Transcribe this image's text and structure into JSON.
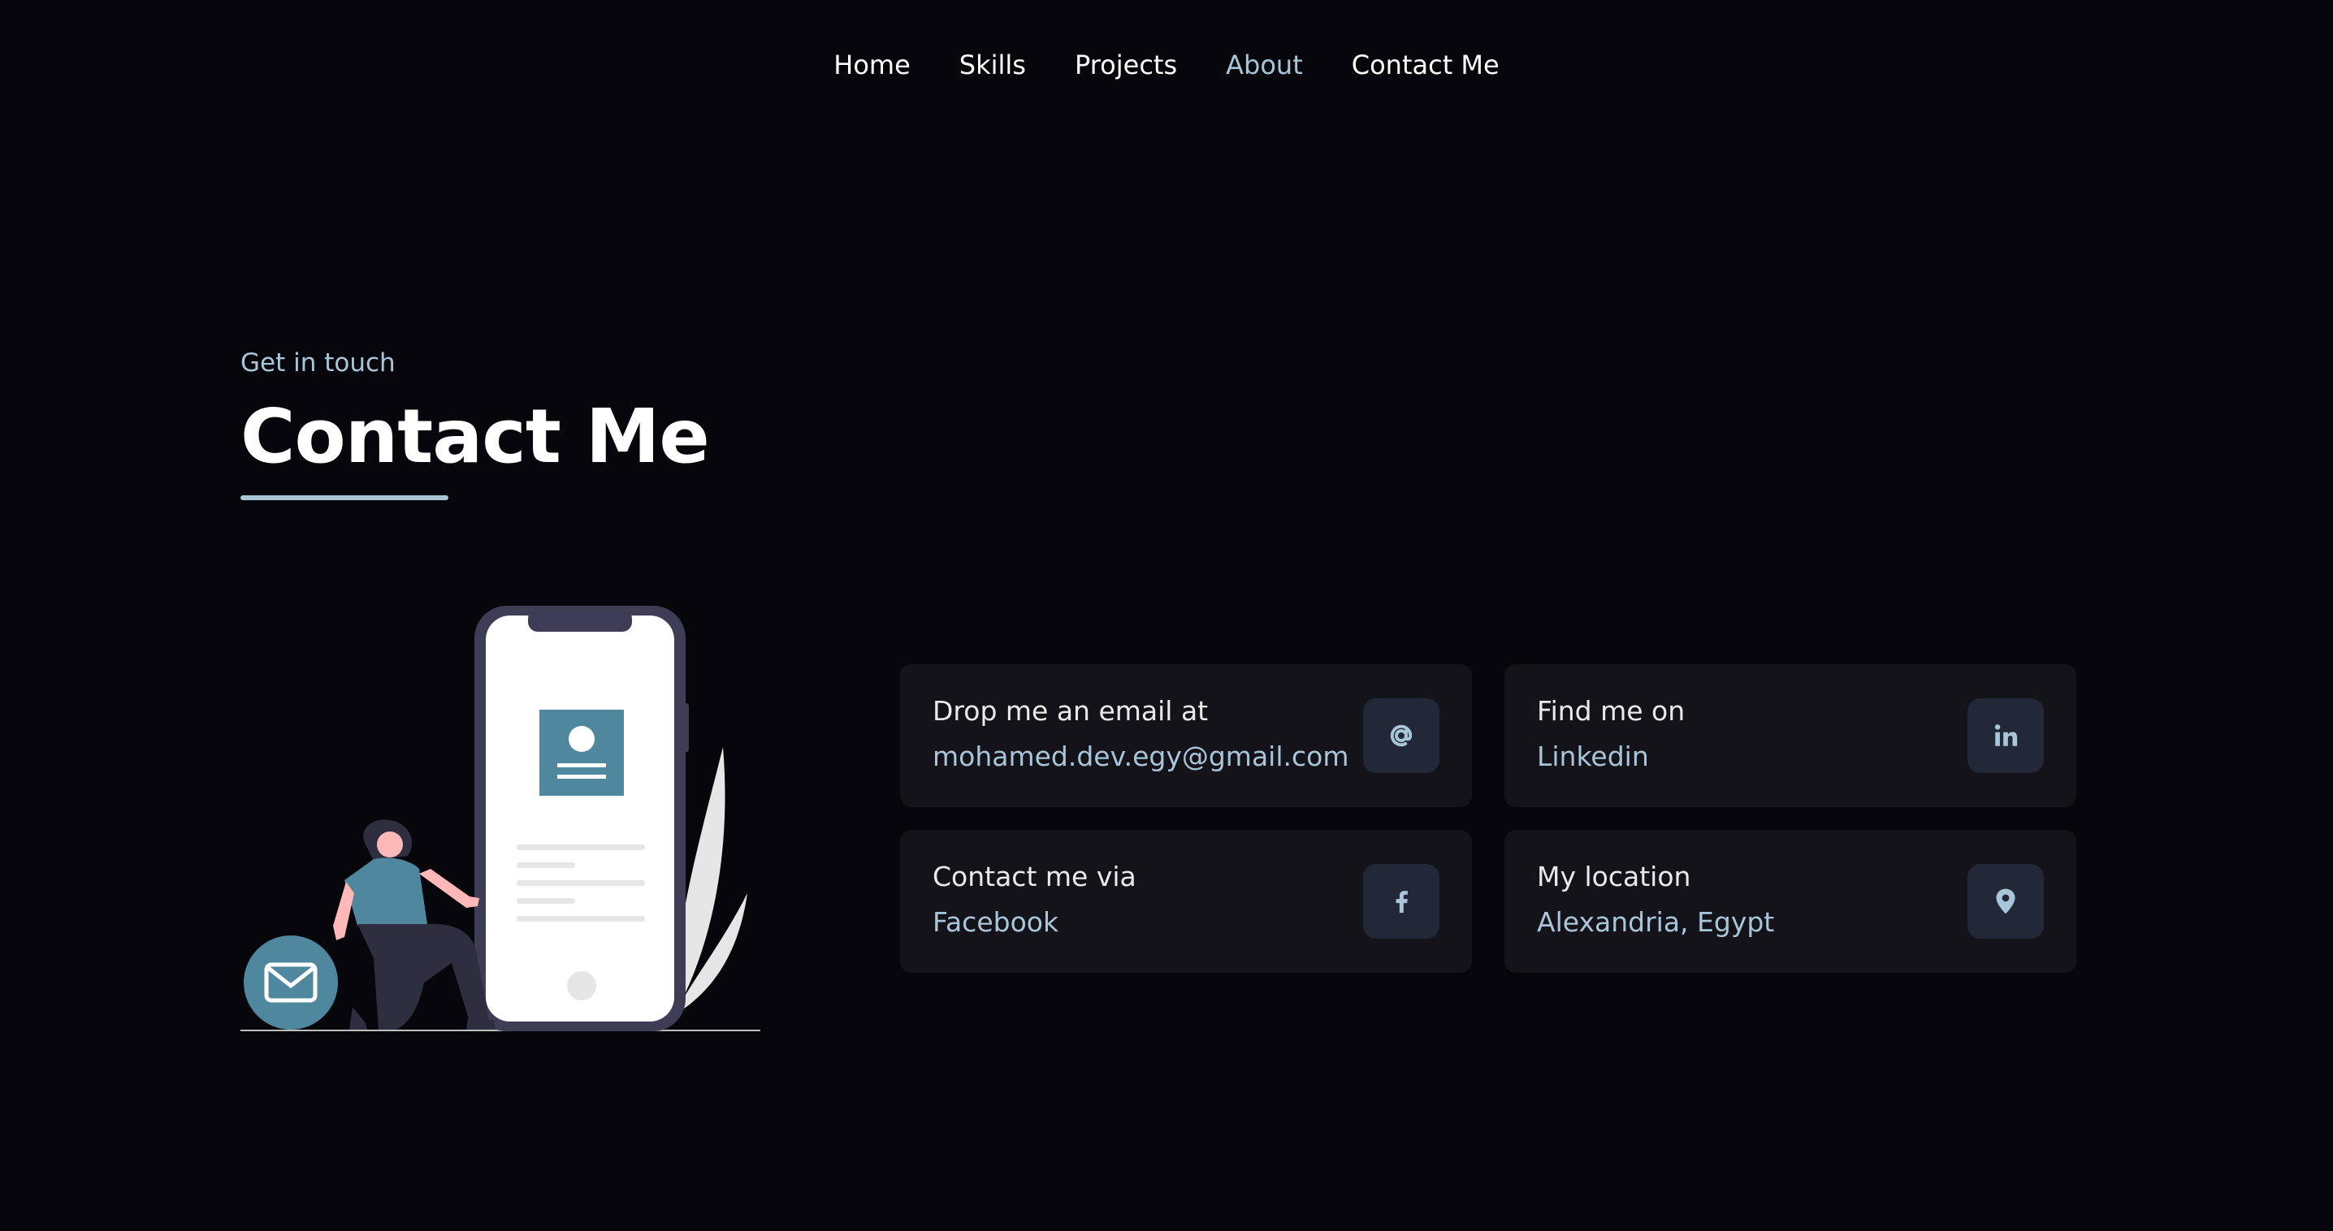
{
  "nav": {
    "items": [
      {
        "label": "Home"
      },
      {
        "label": "Skills"
      },
      {
        "label": "Projects"
      },
      {
        "label": "About"
      },
      {
        "label": "Contact Me"
      }
    ],
    "active": "About"
  },
  "hero": {
    "subtitle": "Get in touch",
    "title": "Contact Me"
  },
  "cards": [
    {
      "label": "Drop me an email at",
      "value": "mohamed.dev.egy@gmail.com",
      "icon": "at-icon"
    },
    {
      "label": "Find me on",
      "value": "Linkedin",
      "icon": "linkedin-icon"
    },
    {
      "label": "Contact me via",
      "value": "Facebook",
      "icon": "facebook-icon"
    },
    {
      "label": "My location",
      "value": "Alexandria, Egypt",
      "icon": "location-pin-icon"
    }
  ],
  "colors": {
    "background": "#07060b",
    "accent": "#a9c6d8",
    "card": "#14131a",
    "icon_bg": "#222838",
    "illustration_blue": "#4f879f"
  }
}
